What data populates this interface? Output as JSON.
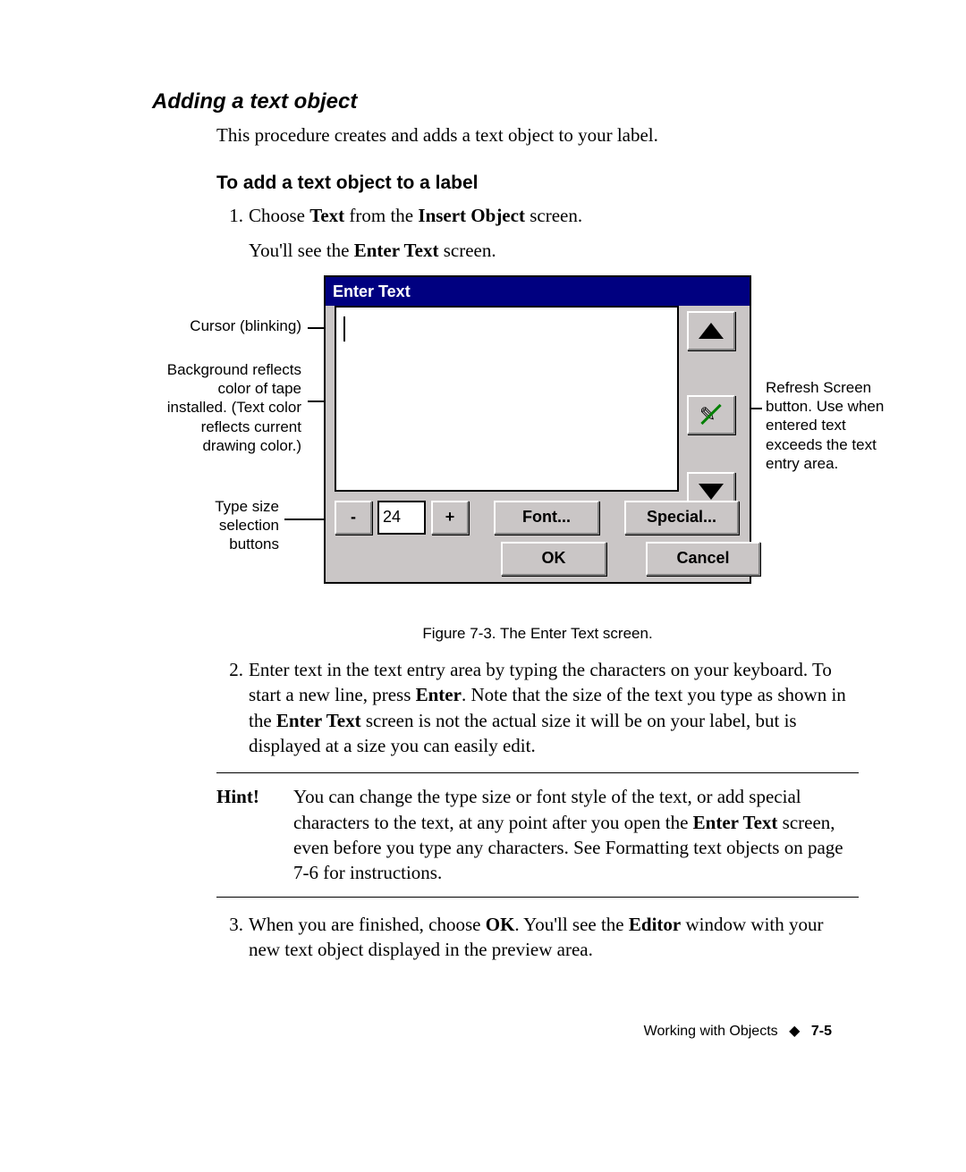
{
  "heading_section": "Adding a text object",
  "intro": "This procedure creates and adds a text object to your label.",
  "heading_sub": "To add a text object to a label",
  "steps": {
    "s1": {
      "num": "1.",
      "t1": "Choose ",
      "b1": "Text",
      "t2": " from the ",
      "b2": "Insert Object",
      "t3": " screen.",
      "sub_t1": "You'll see the ",
      "sub_b1": "Enter Text",
      "sub_t2": " screen."
    },
    "s2": {
      "num": "2.",
      "t1": "Enter text in the text entry area by typing the characters on your keyboard. To start a new line, press ",
      "b1": "Enter",
      "t2": ". Note that the size of the text you type as shown in the ",
      "b2": "Enter Text",
      "t3": " screen is not the actual size it will be on your label, but is displayed at a size you can easily edit."
    },
    "s3": {
      "num": "3.",
      "t1": "When you are finished, choose ",
      "b1": "OK",
      "t2": ". You'll see the ",
      "b2": "Editor",
      "t3": " window with your new text object displayed in the preview area."
    }
  },
  "hint": {
    "label": "Hint!",
    "t1": "You can change the type size or font style of the text, or add special characters to the text, at any point after you open the ",
    "b1": "Enter Text",
    "t2": " screen, even before you type any characters. See Formatting text objects on page 7-6 for instructions."
  },
  "callouts": {
    "cursor": "Cursor (blinking)",
    "background": "Background reflects color of tape installed. (Text color reflects current drawing color.)",
    "typesize": "Type size selection buttons",
    "refresh": "Refresh Screen button. Use when entered text exceeds the text entry area."
  },
  "dialog": {
    "title": "Enter Text",
    "size_value": "24",
    "minus": "-",
    "plus": "+",
    "font": "Font...",
    "special": "Special...",
    "ok": "OK",
    "cancel": "Cancel"
  },
  "figure_caption": "Figure 7-3. The Enter Text screen.",
  "footer": {
    "chapter": "Working with Objects",
    "diamond": "◆",
    "page": "7-5"
  }
}
